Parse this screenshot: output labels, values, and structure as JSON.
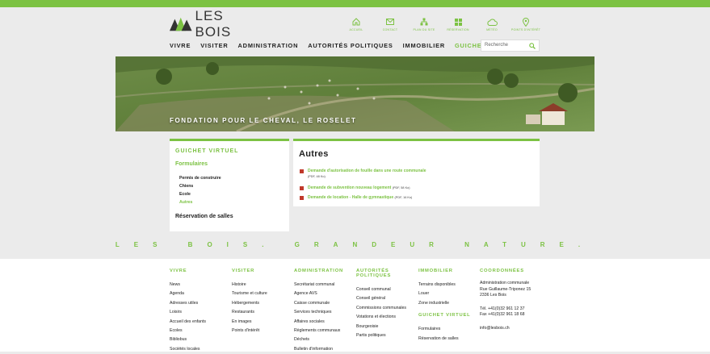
{
  "site": {
    "name": "LES BOIS"
  },
  "quicklinks": [
    {
      "label": "Accueil",
      "icon": "home-icon"
    },
    {
      "label": "Contact",
      "icon": "mail-icon"
    },
    {
      "label": "Plan du site",
      "icon": "sitemap-icon"
    },
    {
      "label": "Réservation",
      "icon": "grid-icon"
    },
    {
      "label": "Météo",
      "icon": "cloud-icon"
    },
    {
      "label": "Points d'intérêt",
      "icon": "location-pin-icon"
    }
  ],
  "nav": [
    {
      "label": "VIVRE"
    },
    {
      "label": "VISITER"
    },
    {
      "label": "ADMINISTRATION"
    },
    {
      "label": "AUTORITÉS POLITIQUES"
    },
    {
      "label": "IMMOBILIER"
    },
    {
      "label": "GUICHET VIRTUEL"
    }
  ],
  "search": {
    "placeholder": "Recherche"
  },
  "hero": {
    "title": "FONDATION POUR LE CHEVAL, LE ROSELET"
  },
  "sidebar": {
    "title": "GUICHET VIRTUEL",
    "subtitle": "Formulaires",
    "items": [
      "Permis de construire",
      "Chiens",
      "Ecole",
      "Autres"
    ],
    "reservation": "Réservation de salles"
  },
  "content": {
    "heading": "Autres",
    "documents": [
      {
        "title": "Demande d'autorisation de fouille dans une route communale",
        "meta": "(PDF, 48 Ko)"
      },
      {
        "title": "Demande de subvention nouveau logement",
        "meta": "(PDF, 58 Ko)"
      },
      {
        "title": "Demande de location - Halle de gymnastique",
        "meta": "(PDF, 16 Ko)"
      }
    ]
  },
  "motto": "LES BOIS. GRANDEUR NATURE.",
  "footer": {
    "vivre": {
      "title": "VIVRE",
      "items": [
        "News",
        "Agenda",
        "Adresses utiles",
        "Loisirs",
        "Accueil des enfants",
        "Ecoles",
        "Bibliobus",
        "Sociétés locales"
      ]
    },
    "visiter": {
      "title": "VISITER",
      "items": [
        "Histoire",
        "Tourisme et culture",
        "Hébergements",
        "Restaurants",
        "En images",
        "Points d'intérêt"
      ]
    },
    "administration": {
      "title": "ADMINISTRATION",
      "items": [
        "Secrétariat communal",
        "Agence AVS",
        "Caisse communale",
        "Services techniques",
        "Affaires sociales",
        "Règlements communaux",
        "Déchets",
        "Bulletin d'information"
      ]
    },
    "autorites": {
      "title": "AUTORITÉS POLITIQUES",
      "items": [
        "Conseil communal",
        "Conseil général",
        "Commissions communales",
        "Votations et élections",
        "Bourgeoisie",
        "Partis politiques"
      ]
    },
    "immobilier": {
      "title": "IMMOBILIER",
      "items": [
        "Terrains disponibles",
        "Louer",
        "Zone industrielle"
      ]
    },
    "guichet": {
      "title": "GUICHET VIRTUEL",
      "items": [
        "Formulaires",
        "Réservation de salles"
      ]
    },
    "coordonnees": {
      "title": "COORDONNÉES",
      "address": [
        "Administration communale",
        "Rue Guillaume-Triponez 15",
        "2336 Les Bois"
      ],
      "phone": "Tél. +41(0)32 961 12 37",
      "fax": "Fax +41(0)32 961 18 68",
      "email": "info@lesbois.ch"
    }
  },
  "colors": {
    "accent": "#7cc243",
    "pdf": "#c0392b"
  }
}
